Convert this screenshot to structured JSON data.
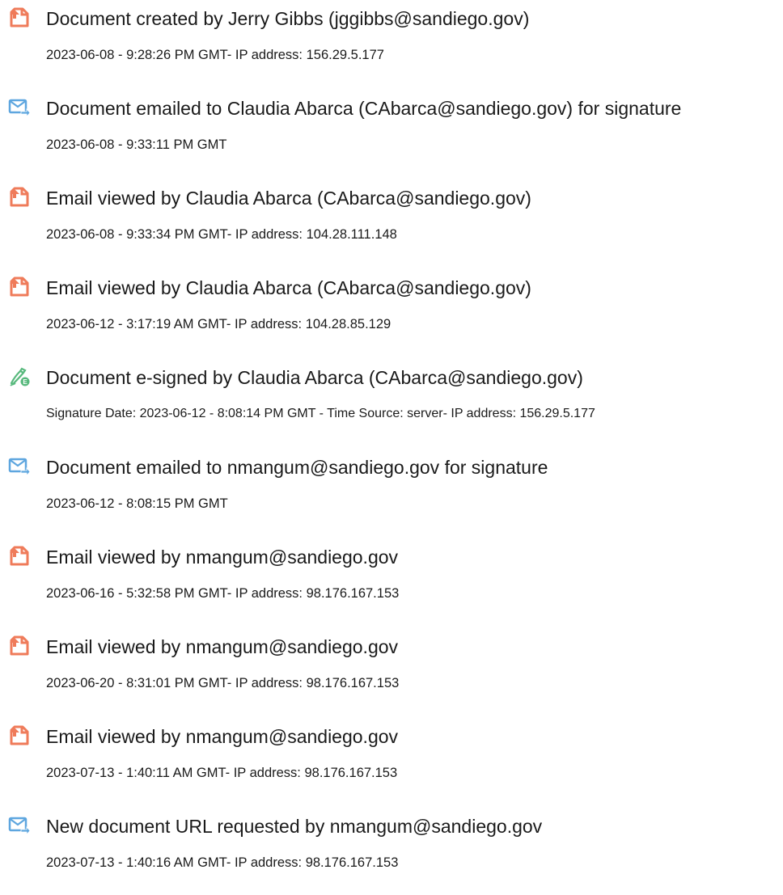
{
  "events": [
    {
      "icon": "document-created-icon",
      "title": "Document created by Jerry Gibbs (jggibbs@sandiego.gov)",
      "detail": "2023-06-08 - 9:28:26 PM GMT- IP address: 156.29.5.177"
    },
    {
      "icon": "document-emailed-icon",
      "title": "Document emailed to Claudia Abarca (CAbarca@sandiego.gov) for signature",
      "detail": "2023-06-08 - 9:33:11 PM GMT"
    },
    {
      "icon": "email-viewed-icon",
      "title": "Email viewed by Claudia Abarca (CAbarca@sandiego.gov)",
      "detail": "2023-06-08 - 9:33:34 PM GMT- IP address: 104.28.111.148"
    },
    {
      "icon": "email-viewed-icon",
      "title": "Email viewed by Claudia Abarca (CAbarca@sandiego.gov)",
      "detail": "2023-06-12 - 3:17:19 AM GMT- IP address: 104.28.85.129"
    },
    {
      "icon": "e-signed-icon",
      "title": "Document e-signed by Claudia Abarca (CAbarca@sandiego.gov)",
      "detail": "Signature Date: 2023-06-12 - 8:08:14 PM GMT - Time Source: server- IP address: 156.29.5.177"
    },
    {
      "icon": "document-emailed-icon",
      "title": "Document emailed to nmangum@sandiego.gov for signature",
      "detail": "2023-06-12 - 8:08:15 PM GMT"
    },
    {
      "icon": "email-viewed-icon",
      "title": "Email viewed by nmangum@sandiego.gov",
      "detail": "2023-06-16 - 5:32:58 PM GMT- IP address: 98.176.167.153"
    },
    {
      "icon": "email-viewed-icon",
      "title": "Email viewed by nmangum@sandiego.gov",
      "detail": "2023-06-20 - 8:31:01 PM GMT- IP address: 98.176.167.153"
    },
    {
      "icon": "email-viewed-icon",
      "title": "Email viewed by nmangum@sandiego.gov",
      "detail": "2023-07-13 - 1:40:11 AM GMT- IP address: 98.176.167.153"
    },
    {
      "icon": "url-requested-icon",
      "title": "New document URL requested by nmangum@sandiego.gov",
      "detail": "2023-07-13 - 1:40:16 AM GMT- IP address: 98.176.167.153"
    }
  ],
  "colors": {
    "doc_icon": "#ef7b5a",
    "email_icon": "#5ea6df",
    "sign_icon": "#58b97d"
  }
}
